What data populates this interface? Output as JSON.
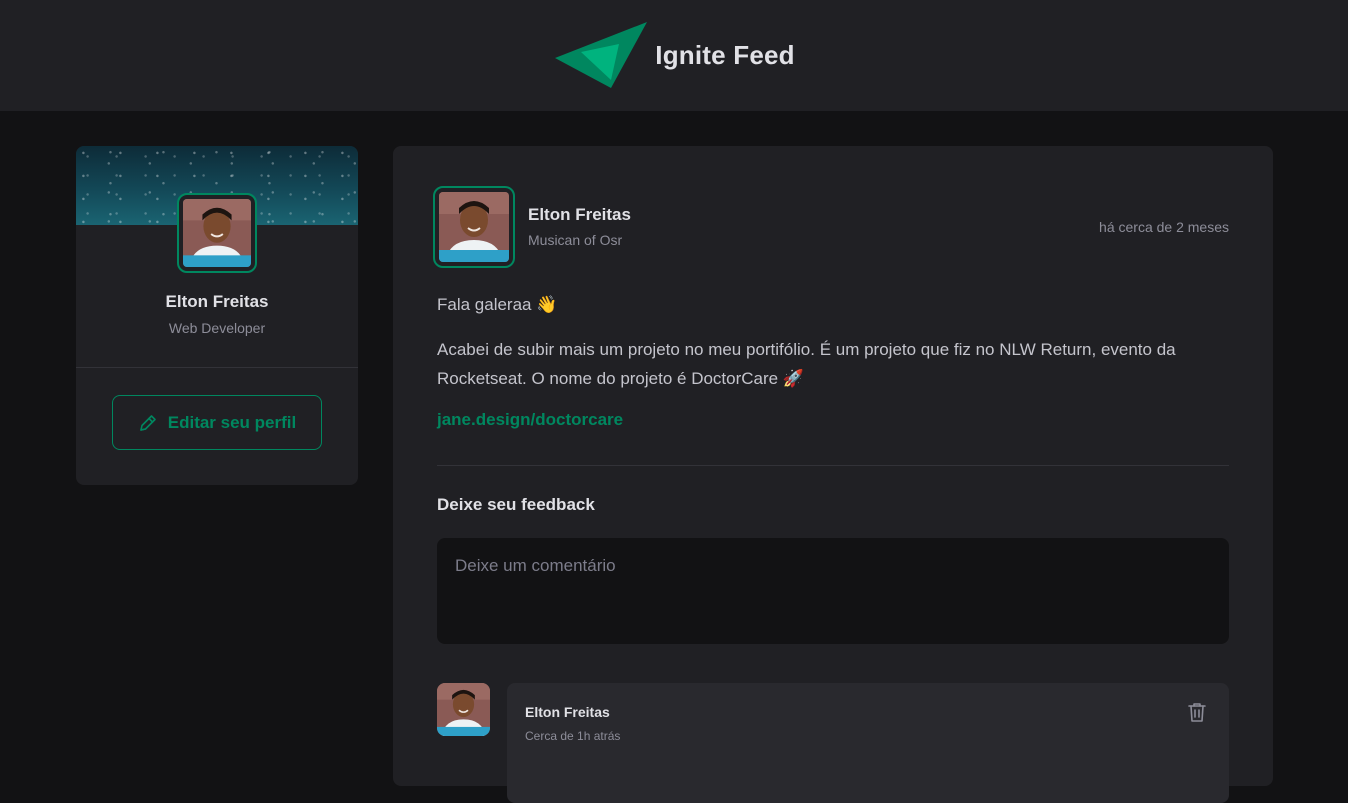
{
  "app": {
    "title": "Ignite Feed",
    "accent": "#00875f",
    "logo_icon": "ignite-logo-icon"
  },
  "sidebar": {
    "name": "Elton Freitas",
    "role": "Web Developer",
    "edit_button_label": "Editar seu perfil",
    "edit_icon": "pencil-icon"
  },
  "post": {
    "author_name": "Elton Freitas",
    "author_role": "Musican of Osr",
    "time": "há cerca de 2 meses",
    "content": [
      "Fala galeraa 👋",
      "Acabei de subir mais um projeto no meu portifólio. É um projeto que fiz no NLW Return, evento da Rocketseat. O nome do projeto é DoctorCare 🚀"
    ],
    "link": "jane.design/doctorcare",
    "feedback_title": "Deixe seu feedback",
    "comment_placeholder": "Deixe um comentário",
    "comment_value": ""
  },
  "comments": [
    {
      "author": "Elton Freitas",
      "time": "Cerca de 1h atrás",
      "text": "",
      "delete_icon": "trash-icon"
    }
  ]
}
